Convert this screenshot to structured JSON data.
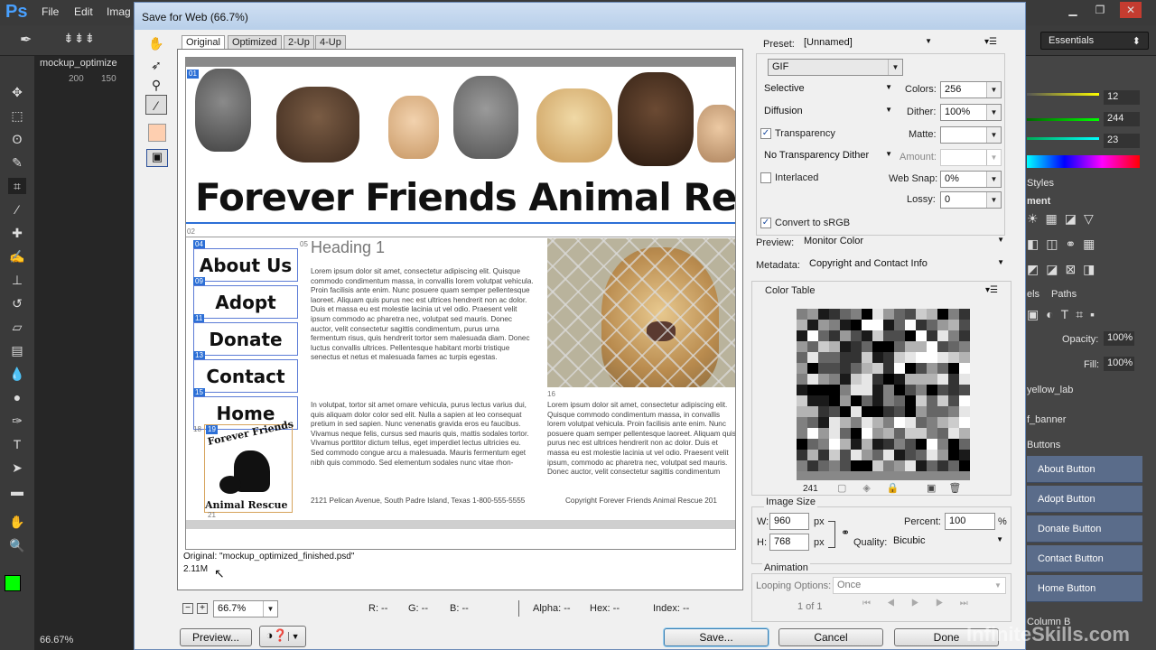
{
  "ps": {
    "logo": "Ps",
    "menu": [
      "File",
      "Edit",
      "Imag"
    ],
    "doc_tab": "mockup_optimize",
    "ruler": [
      "200",
      "150"
    ],
    "zoom_status": "66.67%",
    "workspace": "Essentials",
    "right_panel": {
      "values": [
        "12",
        "244",
        "23"
      ],
      "styles_tab": "Styles",
      "adjust_label": "ment",
      "layers_tabs": [
        "els",
        "Paths"
      ],
      "opacity_label": "Opacity:",
      "opacity_value": "100%",
      "fill_label": "Fill:",
      "fill_value": "100%",
      "layers": [
        "yellow_lab",
        "f_banner",
        "Buttons"
      ],
      "button_layers": [
        "About Button",
        "Adopt Button",
        "Donate Button",
        "Contact Button",
        "Home Button"
      ],
      "last_layer": "Column B"
    }
  },
  "dialog": {
    "title": "Save for Web (66.7%)",
    "tabs": [
      "Original",
      "Optimized",
      "2-Up",
      "4-Up"
    ],
    "preview": {
      "banner_title": "Forever Friends Animal Rescue",
      "nav": [
        "About Us",
        "Adopt",
        "Donate",
        "Contact",
        "Home"
      ],
      "heading": "Heading 1",
      "lorem1": "Lorem ipsum dolor sit amet, consectetur adipiscing elit. Quisque commodo condimentum massa, in convallis lorem volutpat vehicula. Proin facilisis ante enim. Nunc posuere quam semper pellentesque laoreet. Aliquam quis purus nec est ultrices hendrerit non ac dolor. Duis et massa eu est molestie lacinia ut vel odio. Praesent velit ipsum commodo ac pharetra nec, volutpat sed mauris. Donec auctor, velit consectetur sagittis condimentum, purus urna fermentum risus, quis hendrerit tortor sem malesuada diam. Donec luctus convallis ultrices. Pellentesque habitant morbi tristique senectus et netus et malesuada fames ac turpis egestas.",
      "lorem2": "In volutpat, tortor sit amet ornare vehicula, purus lectus varius dui, quis aliquam dolor color sed elit. Nulla a sapien at leo consequat pretium in sed sapien. Nunc venenatis gravida eros eu faucibus. Vivamus neque felis, cursus sed mauris quis, mattis sodales tortor. Vivamus porttitor dictum tellus, eget imperdiet lectus ultricies eu. Sed commodo congue arcu a malesuada. Mauris fermentum eget nibh quis commodo. Sed elementum sodales nunc vitae rhon-",
      "lorem3": "Lorem ipsum dolor sit amet, consectetur adipiscing elit. Quisque commodo condimentum massa, in convallis lorem volutpat vehicula. Proin facilisis ante enim. Nunc posuere quam semper pellentesque laoreet. Aliquam quis purus nec est ultrices hendrerit non ac dolor. Duis et massa eu est molestie lacinia ut vel odio. Praesent velit ipsum, commodo ac pharetra nec, volutpat sed mauris. Donec auctor, velit consectetur sagittis condimentum",
      "address": "2121 Pelican Avenue, South Padre Island, Texas 1-800-555-5555",
      "copyright": "Copyright Forever Friends Animal Rescue 201",
      "logo_top": "Forever Friends",
      "logo_bottom": "Animal Rescue",
      "slice_nums": [
        "01",
        "02",
        "04",
        "05",
        "06",
        "09",
        "11",
        "13",
        "15",
        "16",
        "18",
        "19",
        "21"
      ]
    },
    "info": {
      "file": "Original: \"mockup_optimized_finished.psd\"",
      "size": "2.11M"
    },
    "status": {
      "zoom": "66.7%",
      "r": "R: --",
      "g": "G: --",
      "b": "B: --",
      "alpha": "Alpha: --",
      "hex": "Hex: --",
      "index": "Index: --"
    },
    "buttons": {
      "preview": "Preview...",
      "save": "Save...",
      "cancel": "Cancel",
      "done": "Done"
    },
    "settings": {
      "preset_label": "Preset:",
      "preset": "[Unnamed]",
      "format": "GIF",
      "reduction": "Selective",
      "colors_label": "Colors:",
      "colors": "256",
      "dither_algo": "Diffusion",
      "dither_label": "Dither:",
      "dither": "100%",
      "transparency": "Transparency",
      "matte_label": "Matte:",
      "transparency_dither": "No Transparency Dither",
      "amount_label": "Amount:",
      "interlaced": "Interlaced",
      "websnap_label": "Web Snap:",
      "websnap": "0%",
      "lossy_label": "Lossy:",
      "lossy": "0",
      "srgb": "Convert to sRGB",
      "preview_label": "Preview:",
      "preview_value": "Monitor Color",
      "metadata_label": "Metadata:",
      "metadata_value": "Copyright and Contact Info",
      "color_table_title": "Color Table",
      "color_count": "241",
      "image_size_title": "Image Size",
      "w_label": "W:",
      "w": "960",
      "h_label": "H:",
      "h": "768",
      "px": "px",
      "percent_label": "Percent:",
      "percent": "100",
      "percent_unit": "%",
      "quality_label": "Quality:",
      "quality": "Bicubic",
      "animation_title": "Animation",
      "looping_label": "Looping Options:",
      "looping": "Once",
      "frame": "1 of 1"
    }
  },
  "watermark": "InfiniteSkills.com"
}
